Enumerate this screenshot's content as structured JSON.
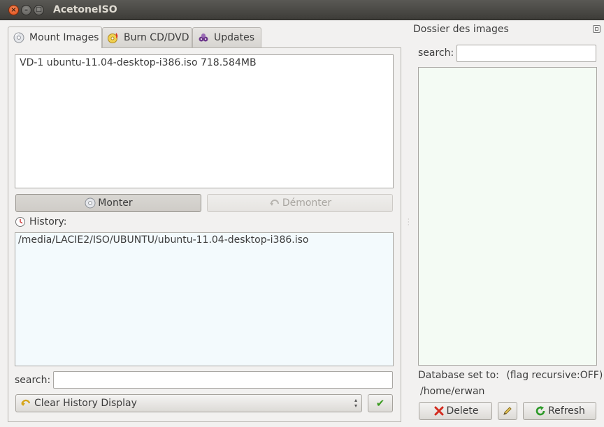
{
  "window": {
    "title": "AcetoneISO",
    "close_glyph": "×",
    "min_glyph": "–",
    "max_glyph": "□"
  },
  "tabs": [
    {
      "label": "Mount Images",
      "icon": "disc-icon"
    },
    {
      "label": "Burn CD/DVD",
      "icon": "burn-icon"
    },
    {
      "label": "Updates",
      "icon": "updates-icon"
    }
  ],
  "mounted": {
    "items": [
      "VD-1 ubuntu-11.04-desktop-i386.iso  718.584MB"
    ]
  },
  "buttons": {
    "mount": "Monter",
    "unmount": "Démonter",
    "clear_history": "Clear History Display",
    "confirm_glyph": "✔",
    "delete": "Delete",
    "refresh": "Refresh"
  },
  "history": {
    "label": "History:",
    "items": [
      "/media/LACIE2/ISO/UBUNTU/ubuntu-11.04-desktop-i386.iso"
    ],
    "search_label": "search:",
    "search_value": ""
  },
  "right_panel": {
    "title": "Dossier des images",
    "search_label": "search:",
    "search_value": "",
    "database_label": "Database set to:",
    "flag_text": "(flag recursive:OFF)",
    "database_path": "/home/erwan"
  },
  "colors": {
    "titlebar": "#3d3c38",
    "close_button": "#de4b16",
    "history_bg": "#f3fafd",
    "right_list_bg": "#f4fbf4"
  }
}
